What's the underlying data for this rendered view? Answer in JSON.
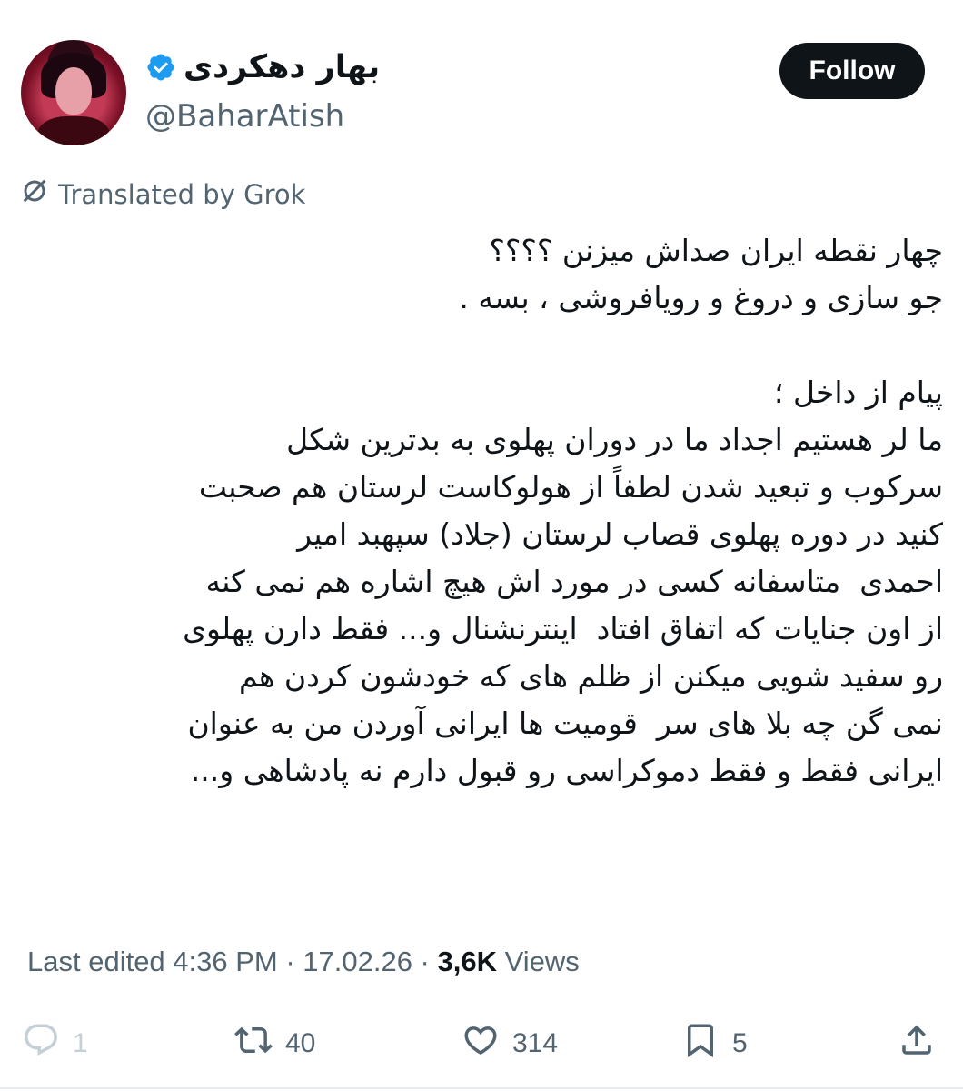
{
  "author": {
    "display_name": "بهار دهکردی",
    "handle": "@BaharAtish",
    "verified": true,
    "avatar_icon": "profile-photo"
  },
  "follow_label": "Follow",
  "translated_label": "Translated by Grok",
  "tweet": {
    "lines": [
      "چهار نقطه ایران صداش میزنن ؟؟؟؟",
      "جو سازی و دروغ و رویافروشی ، بسه .",
      "",
      "پیام از داخل ؛",
      "ما لر هستیم اجداد ما در دوران پهلوی به بدترین شکل",
      "سرکوب و تبعید شدن لطفاً از هولوکاست لرستان هم صحبت",
      "کنید در دوره پهلوی قصاب لرستان (جلاد) سپهبد امیر",
      "احمدی  متاسفانه کسی در مورد اش هیچ اشاره هم نمی کنه",
      "از اون جنایات که اتفاق افتاد  اینترنشنال و... فقط دارن پهلوی",
      "رو سفید شویی میکنن از ظلم های که خودشون کردن هم",
      "نمی گن چه بلا های سر  قومیت ها ایرانی آوردن من به عنوان",
      "ایرانی فقط و فقط دموکراسی رو قبول دارم نه پادشاهی و..."
    ]
  },
  "meta": {
    "edited_label": "Last edited 4:36 PM · 17.02.26 · ",
    "views_count": "3,6K",
    "views_label": " Views"
  },
  "actions": {
    "replies": "1",
    "reposts": "40",
    "likes": "314",
    "bookmarks": "5"
  },
  "colors": {
    "text_primary": "#0f1419",
    "text_secondary": "#536471",
    "verified_blue": "#1d9bf0",
    "follow_bg": "#0f1419"
  }
}
